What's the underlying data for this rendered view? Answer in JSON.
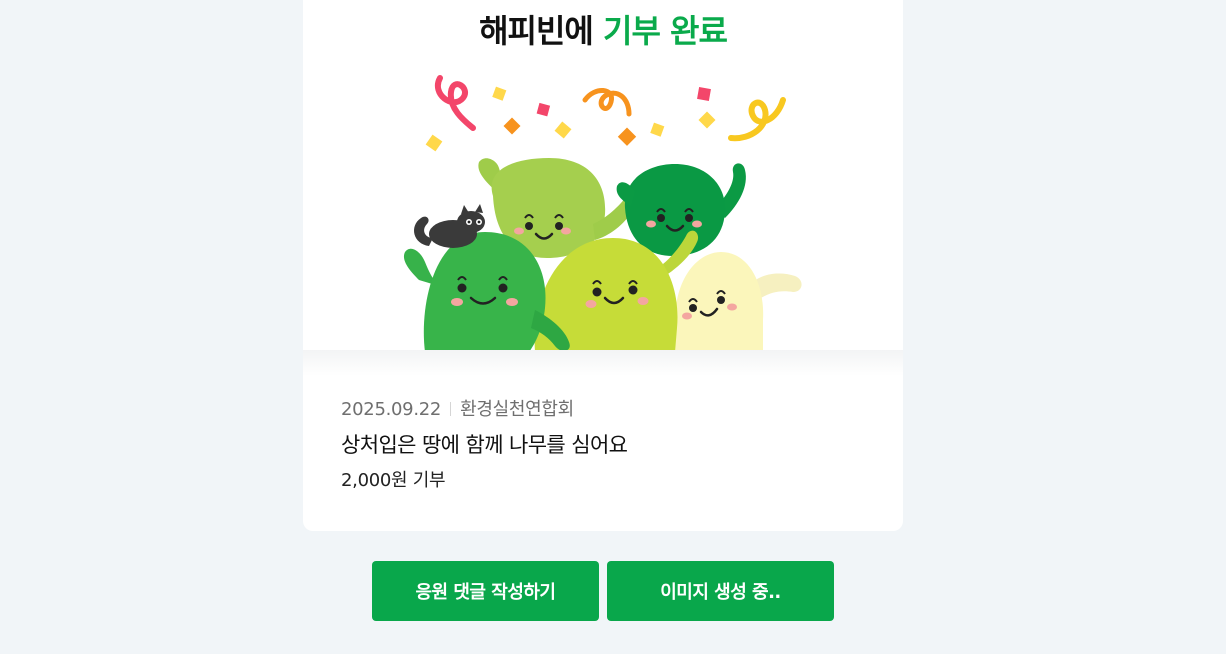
{
  "header": {
    "title_part1": "해피빈에 ",
    "title_part2": "기부 완료"
  },
  "donation": {
    "date": "2025.09.22",
    "organization": "환경실천연합회",
    "campaign_title": "상처입은 땅에 함께 나무를 심어요",
    "amount": "2,000원 기부"
  },
  "actions": {
    "comment_label": "응원 댓글 작성하기",
    "image_label": "이미지 생성 중.."
  },
  "colors": {
    "accent": "#0aaa4b",
    "button": "#09a74b",
    "background": "#f1f5f8"
  }
}
